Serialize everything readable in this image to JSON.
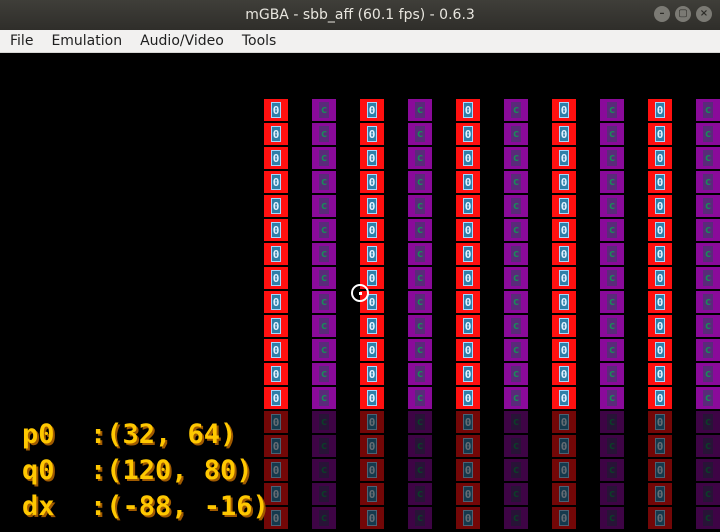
{
  "window": {
    "title": "mGBA - sbb_aff (60.1 fps) - 0.6.3",
    "buttons": [
      "–",
      "▢",
      "×"
    ]
  },
  "menu": {
    "items": [
      "File",
      "Emulation",
      "Audio/Video",
      "Tools"
    ]
  },
  "game": {
    "tile_red_glyph": "0",
    "tile_purple_glyph": "c",
    "colors": {
      "red_tile": "#ff1010",
      "purple_tile": "#8a0a9a",
      "hud_text": "#ffc800"
    },
    "hud": [
      {
        "label": "p0",
        "value": ":(32, 64)"
      },
      {
        "label": "q0",
        "value": ":(120, 80)"
      },
      {
        "label": "dx",
        "value": ":(-88, -16)"
      }
    ]
  }
}
